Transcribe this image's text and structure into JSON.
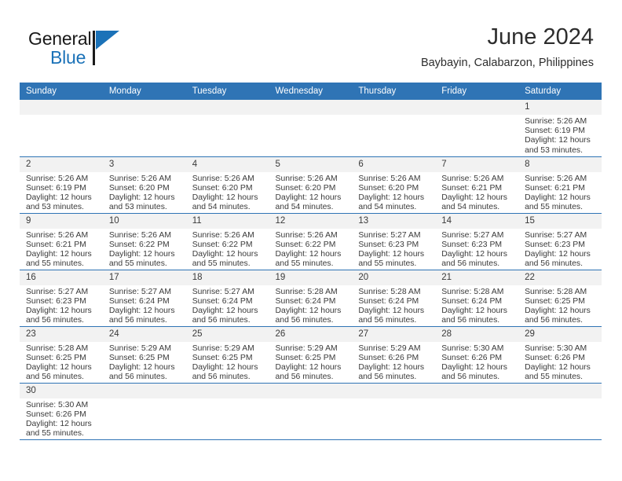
{
  "logo": {
    "primary": "General",
    "secondary": "Blue",
    "triangle_icon": "triangle-icon"
  },
  "header": {
    "title": "June 2024",
    "location": "Baybayin, Calabarzon, Philippines"
  },
  "colors": {
    "header_blue": "#2f74b5",
    "row_border_blue": "#2f74b5",
    "daynum_gray": "#f2f2f2",
    "logo_blue": "#1b72b8"
  },
  "weekday_headers": [
    "Sunday",
    "Monday",
    "Tuesday",
    "Wednesday",
    "Thursday",
    "Friday",
    "Saturday"
  ],
  "labels": {
    "sunrise": "Sunrise:",
    "sunset": "Sunset:",
    "daylight": "Daylight:"
  },
  "weeks": [
    [
      {
        "day": "",
        "empty": true
      },
      {
        "day": "",
        "empty": true
      },
      {
        "day": "",
        "empty": true
      },
      {
        "day": "",
        "empty": true
      },
      {
        "day": "",
        "empty": true
      },
      {
        "day": "",
        "empty": true
      },
      {
        "day": "1",
        "sunrise": "Sunrise: 5:26 AM",
        "sunset": "Sunset: 6:19 PM",
        "daylight": "Daylight: 12 hours and 53 minutes."
      }
    ],
    [
      {
        "day": "2",
        "sunrise": "Sunrise: 5:26 AM",
        "sunset": "Sunset: 6:19 PM",
        "daylight": "Daylight: 12 hours and 53 minutes."
      },
      {
        "day": "3",
        "sunrise": "Sunrise: 5:26 AM",
        "sunset": "Sunset: 6:20 PM",
        "daylight": "Daylight: 12 hours and 53 minutes."
      },
      {
        "day": "4",
        "sunrise": "Sunrise: 5:26 AM",
        "sunset": "Sunset: 6:20 PM",
        "daylight": "Daylight: 12 hours and 54 minutes."
      },
      {
        "day": "5",
        "sunrise": "Sunrise: 5:26 AM",
        "sunset": "Sunset: 6:20 PM",
        "daylight": "Daylight: 12 hours and 54 minutes."
      },
      {
        "day": "6",
        "sunrise": "Sunrise: 5:26 AM",
        "sunset": "Sunset: 6:20 PM",
        "daylight": "Daylight: 12 hours and 54 minutes."
      },
      {
        "day": "7",
        "sunrise": "Sunrise: 5:26 AM",
        "sunset": "Sunset: 6:21 PM",
        "daylight": "Daylight: 12 hours and 54 minutes."
      },
      {
        "day": "8",
        "sunrise": "Sunrise: 5:26 AM",
        "sunset": "Sunset: 6:21 PM",
        "daylight": "Daylight: 12 hours and 55 minutes."
      }
    ],
    [
      {
        "day": "9",
        "sunrise": "Sunrise: 5:26 AM",
        "sunset": "Sunset: 6:21 PM",
        "daylight": "Daylight: 12 hours and 55 minutes."
      },
      {
        "day": "10",
        "sunrise": "Sunrise: 5:26 AM",
        "sunset": "Sunset: 6:22 PM",
        "daylight": "Daylight: 12 hours and 55 minutes."
      },
      {
        "day": "11",
        "sunrise": "Sunrise: 5:26 AM",
        "sunset": "Sunset: 6:22 PM",
        "daylight": "Daylight: 12 hours and 55 minutes."
      },
      {
        "day": "12",
        "sunrise": "Sunrise: 5:26 AM",
        "sunset": "Sunset: 6:22 PM",
        "daylight": "Daylight: 12 hours and 55 minutes."
      },
      {
        "day": "13",
        "sunrise": "Sunrise: 5:27 AM",
        "sunset": "Sunset: 6:23 PM",
        "daylight": "Daylight: 12 hours and 55 minutes."
      },
      {
        "day": "14",
        "sunrise": "Sunrise: 5:27 AM",
        "sunset": "Sunset: 6:23 PM",
        "daylight": "Daylight: 12 hours and 56 minutes."
      },
      {
        "day": "15",
        "sunrise": "Sunrise: 5:27 AM",
        "sunset": "Sunset: 6:23 PM",
        "daylight": "Daylight: 12 hours and 56 minutes."
      }
    ],
    [
      {
        "day": "16",
        "sunrise": "Sunrise: 5:27 AM",
        "sunset": "Sunset: 6:23 PM",
        "daylight": "Daylight: 12 hours and 56 minutes."
      },
      {
        "day": "17",
        "sunrise": "Sunrise: 5:27 AM",
        "sunset": "Sunset: 6:24 PM",
        "daylight": "Daylight: 12 hours and 56 minutes."
      },
      {
        "day": "18",
        "sunrise": "Sunrise: 5:27 AM",
        "sunset": "Sunset: 6:24 PM",
        "daylight": "Daylight: 12 hours and 56 minutes."
      },
      {
        "day": "19",
        "sunrise": "Sunrise: 5:28 AM",
        "sunset": "Sunset: 6:24 PM",
        "daylight": "Daylight: 12 hours and 56 minutes."
      },
      {
        "day": "20",
        "sunrise": "Sunrise: 5:28 AM",
        "sunset": "Sunset: 6:24 PM",
        "daylight": "Daylight: 12 hours and 56 minutes."
      },
      {
        "day": "21",
        "sunrise": "Sunrise: 5:28 AM",
        "sunset": "Sunset: 6:24 PM",
        "daylight": "Daylight: 12 hours and 56 minutes."
      },
      {
        "day": "22",
        "sunrise": "Sunrise: 5:28 AM",
        "sunset": "Sunset: 6:25 PM",
        "daylight": "Daylight: 12 hours and 56 minutes."
      }
    ],
    [
      {
        "day": "23",
        "sunrise": "Sunrise: 5:28 AM",
        "sunset": "Sunset: 6:25 PM",
        "daylight": "Daylight: 12 hours and 56 minutes."
      },
      {
        "day": "24",
        "sunrise": "Sunrise: 5:29 AM",
        "sunset": "Sunset: 6:25 PM",
        "daylight": "Daylight: 12 hours and 56 minutes."
      },
      {
        "day": "25",
        "sunrise": "Sunrise: 5:29 AM",
        "sunset": "Sunset: 6:25 PM",
        "daylight": "Daylight: 12 hours and 56 minutes."
      },
      {
        "day": "26",
        "sunrise": "Sunrise: 5:29 AM",
        "sunset": "Sunset: 6:25 PM",
        "daylight": "Daylight: 12 hours and 56 minutes."
      },
      {
        "day": "27",
        "sunrise": "Sunrise: 5:29 AM",
        "sunset": "Sunset: 6:26 PM",
        "daylight": "Daylight: 12 hours and 56 minutes."
      },
      {
        "day": "28",
        "sunrise": "Sunrise: 5:30 AM",
        "sunset": "Sunset: 6:26 PM",
        "daylight": "Daylight: 12 hours and 56 minutes."
      },
      {
        "day": "29",
        "sunrise": "Sunrise: 5:30 AM",
        "sunset": "Sunset: 6:26 PM",
        "daylight": "Daylight: 12 hours and 55 minutes."
      }
    ],
    [
      {
        "day": "30",
        "sunrise": "Sunrise: 5:30 AM",
        "sunset": "Sunset: 6:26 PM",
        "daylight": "Daylight: 12 hours and 55 minutes."
      },
      {
        "day": "",
        "empty": true
      },
      {
        "day": "",
        "empty": true
      },
      {
        "day": "",
        "empty": true
      },
      {
        "day": "",
        "empty": true
      },
      {
        "day": "",
        "empty": true
      },
      {
        "day": "",
        "empty": true
      }
    ]
  ]
}
